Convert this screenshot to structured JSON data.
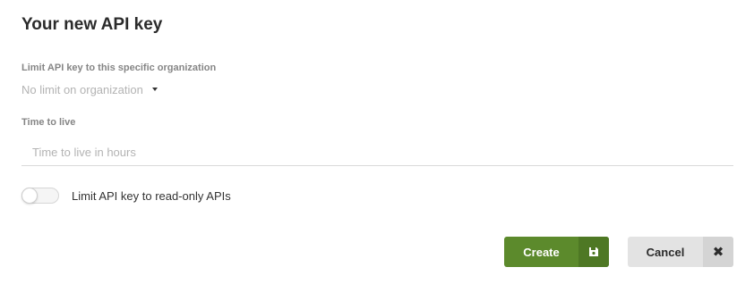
{
  "dialog": {
    "title": "Your new API key"
  },
  "organization": {
    "label": "Limit API key to this specific organization",
    "selected_value": "No limit on organization",
    "caret_icon": "caret-down-icon"
  },
  "ttl": {
    "label": "Time to live",
    "value": "",
    "placeholder": "Time to live in hours"
  },
  "read_only": {
    "label": "Limit API key to read-only APIs",
    "enabled": false
  },
  "actions": {
    "create_label": "Create",
    "create_icon": "save-icon",
    "cancel_label": "Cancel",
    "cancel_icon": "close-icon"
  },
  "colors": {
    "create_bg": "#5c8a2c",
    "create_icon_bg": "#4e7824",
    "cancel_bg": "#e3e3e3",
    "cancel_icon_bg": "#d4d4d4",
    "label_gray": "#858585",
    "placeholder_gray": "#b3b3b3"
  }
}
